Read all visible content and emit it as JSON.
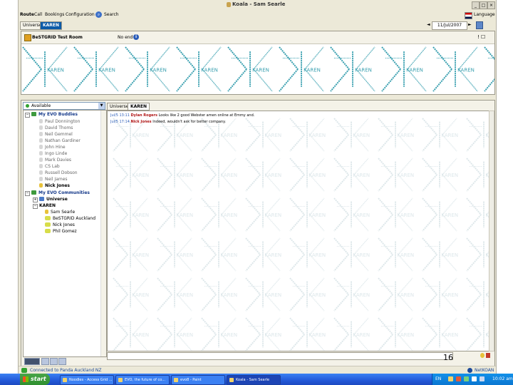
{
  "window": {
    "title": "Koala - Sam Searle",
    "controls": [
      "_",
      "□",
      "×"
    ]
  },
  "menu": {
    "items": [
      "Route",
      "Call",
      "Bookings",
      "Configuration",
      "Search"
    ],
    "language_label": "Language"
  },
  "tabs": {
    "items": [
      "Universe",
      "KAREN"
    ],
    "active": "KAREN"
  },
  "date": {
    "value": "11/Jul/2007",
    "prev": "◄",
    "next": "►"
  },
  "room": {
    "name": "BeSTGRID Test Room",
    "status": "No end",
    "info_glyph": "i",
    "tools": "! ☐"
  },
  "banner": {
    "word": "KAREN"
  },
  "status_select": {
    "value": "Available",
    "arrow": "▼"
  },
  "buddies": {
    "group_label": "My EVO Buddies",
    "items": [
      {
        "name": "Paul Donnington",
        "online": false
      },
      {
        "name": "David Thoms",
        "online": false
      },
      {
        "name": "Neil Gemmel",
        "online": false
      },
      {
        "name": "Nathan Gardiner",
        "online": false
      },
      {
        "name": "John Hine",
        "online": false
      },
      {
        "name": "Ingo Linde",
        "online": false
      },
      {
        "name": "Mark Davies",
        "online": false
      },
      {
        "name": "CS Lab",
        "online": false
      },
      {
        "name": "Russell Dobson",
        "online": false
      },
      {
        "name": "Neil James",
        "online": false
      },
      {
        "name": "Nick Jones",
        "online": true
      }
    ]
  },
  "communities": {
    "group_label": "My EVO Communities",
    "items": [
      {
        "name": "Universe",
        "expander": "+"
      },
      {
        "name": "KAREN",
        "expander": "−"
      }
    ],
    "karen_members": [
      "Sam Searle",
      "BeSTGRID Auckland",
      "Nick Jones",
      "Phil Gomez"
    ]
  },
  "chat": {
    "tabs": [
      "Universe",
      "KAREN"
    ],
    "active_tab": "KAREN",
    "messages": [
      {
        "time": "Jul/5 13:11",
        "user": "Dylan Rogers",
        "text": "Looks like 2 good Webster amen online at Emmy and."
      },
      {
        "time": "Jul/5 17:14",
        "user": "Nick Jones",
        "text": "Indeed, wouldn't ask for better company."
      }
    ]
  },
  "slide_number": "16",
  "status_bar": {
    "connection": "Connected to Panda Auckland NZ",
    "brand": "NetKOAN"
  },
  "taskbar": {
    "start_label": "start",
    "tasks": [
      {
        "label": "Noodles - Access Grid ...",
        "active": false
      },
      {
        "label": "EVO, the future of co...",
        "active": false
      },
      {
        "label": "evo8 - Paint",
        "active": false
      },
      {
        "label": "Koala - Sam Searle",
        "active": true
      }
    ],
    "tray_language": "EN",
    "clock": "10:02 am"
  },
  "colors": {
    "titlebar_blue": "#0c5ba8",
    "banner_teal": "#3aa0b0",
    "online_yellow": "#e8c23a",
    "group_green": "#3e9a3e",
    "taskbar_blue": "#2359d8",
    "start_green": "#3a9a3a"
  }
}
